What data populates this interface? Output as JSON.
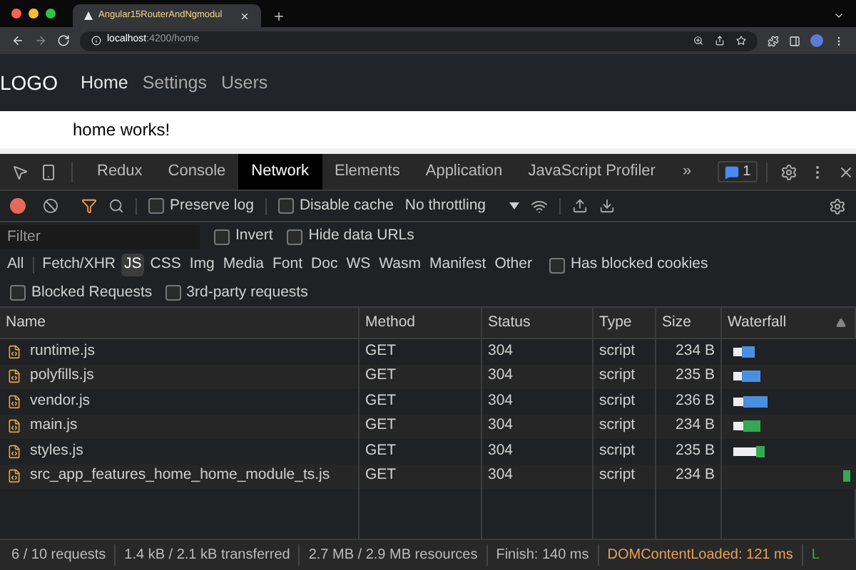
{
  "browser": {
    "tab_title": "Angular15RouterAndNgmodul",
    "url_host": "localhost",
    "url_path": ":4200/home"
  },
  "app_nav": {
    "logo": "LOGO",
    "links": [
      {
        "label": "Home",
        "selected": true
      },
      {
        "label": "Settings",
        "selected": false
      },
      {
        "label": "Users",
        "selected": false
      }
    ]
  },
  "page_content": "home works!",
  "devtools": {
    "tabs": [
      {
        "label": "Redux",
        "selected": false
      },
      {
        "label": "Console",
        "selected": false
      },
      {
        "label": "Network",
        "selected": true
      },
      {
        "label": "Elements",
        "selected": false
      },
      {
        "label": "Application",
        "selected": false
      },
      {
        "label": "JavaScript Profiler",
        "selected": false
      }
    ],
    "more_tabs": "»",
    "issues_count": "1",
    "toolbar": {
      "recording": true,
      "preserve_log": {
        "label": "Preserve log",
        "checked": false
      },
      "disable_cache": {
        "label": "Disable cache",
        "checked": false
      },
      "throttling": "No throttling"
    },
    "filter": {
      "placeholder": "Filter",
      "invert": {
        "label": "Invert",
        "checked": false
      },
      "hide_data_urls": {
        "label": "Hide data URLs",
        "checked": false
      }
    },
    "type_filters": [
      {
        "label": "All",
        "selected": false
      },
      {
        "label": "Fetch/XHR",
        "selected": false
      },
      {
        "label": "JS",
        "selected": true
      },
      {
        "label": "CSS",
        "selected": false
      },
      {
        "label": "Img",
        "selected": false
      },
      {
        "label": "Media",
        "selected": false
      },
      {
        "label": "Font",
        "selected": false
      },
      {
        "label": "Doc",
        "selected": false
      },
      {
        "label": "WS",
        "selected": false
      },
      {
        "label": "Wasm",
        "selected": false
      },
      {
        "label": "Manifest",
        "selected": false
      },
      {
        "label": "Other",
        "selected": false
      }
    ],
    "has_blocked_cookies": {
      "label": "Has blocked cookies",
      "checked": false
    },
    "blocked_requests": {
      "label": "Blocked Requests",
      "checked": false
    },
    "third_party": {
      "label": "3rd-party requests",
      "checked": false
    },
    "table": {
      "columns": [
        "Name",
        "Method",
        "Status",
        "Type",
        "Size",
        "Waterfall"
      ],
      "rows": [
        {
          "name": "runtime.js",
          "method": "GET",
          "status": "304",
          "type": "script",
          "size": "234 B"
        },
        {
          "name": "polyfills.js",
          "method": "GET",
          "status": "304",
          "type": "script",
          "size": "235 B"
        },
        {
          "name": "vendor.js",
          "method": "GET",
          "status": "304",
          "type": "script",
          "size": "236 B"
        },
        {
          "name": "main.js",
          "method": "GET",
          "status": "304",
          "type": "script",
          "size": "234 B"
        },
        {
          "name": "styles.js",
          "method": "GET",
          "status": "304",
          "type": "script",
          "size": "235 B"
        },
        {
          "name": "src_app_features_home_home_module_ts.js",
          "method": "GET",
          "status": "304",
          "type": "script",
          "size": "234 B"
        }
      ]
    },
    "status_bar": [
      {
        "text": "6 / 10 requests",
        "kind": "plain"
      },
      {
        "text": "1.4 kB / 2.1 kB transferred",
        "kind": "plain"
      },
      {
        "text": "2.7 MB / 2.9 MB resources",
        "kind": "plain"
      },
      {
        "text": "Finish: 140 ms",
        "kind": "plain"
      },
      {
        "text": "DOMContentLoaded: 121 ms",
        "kind": "dcl"
      },
      {
        "text": "L",
        "kind": "load"
      }
    ]
  }
}
